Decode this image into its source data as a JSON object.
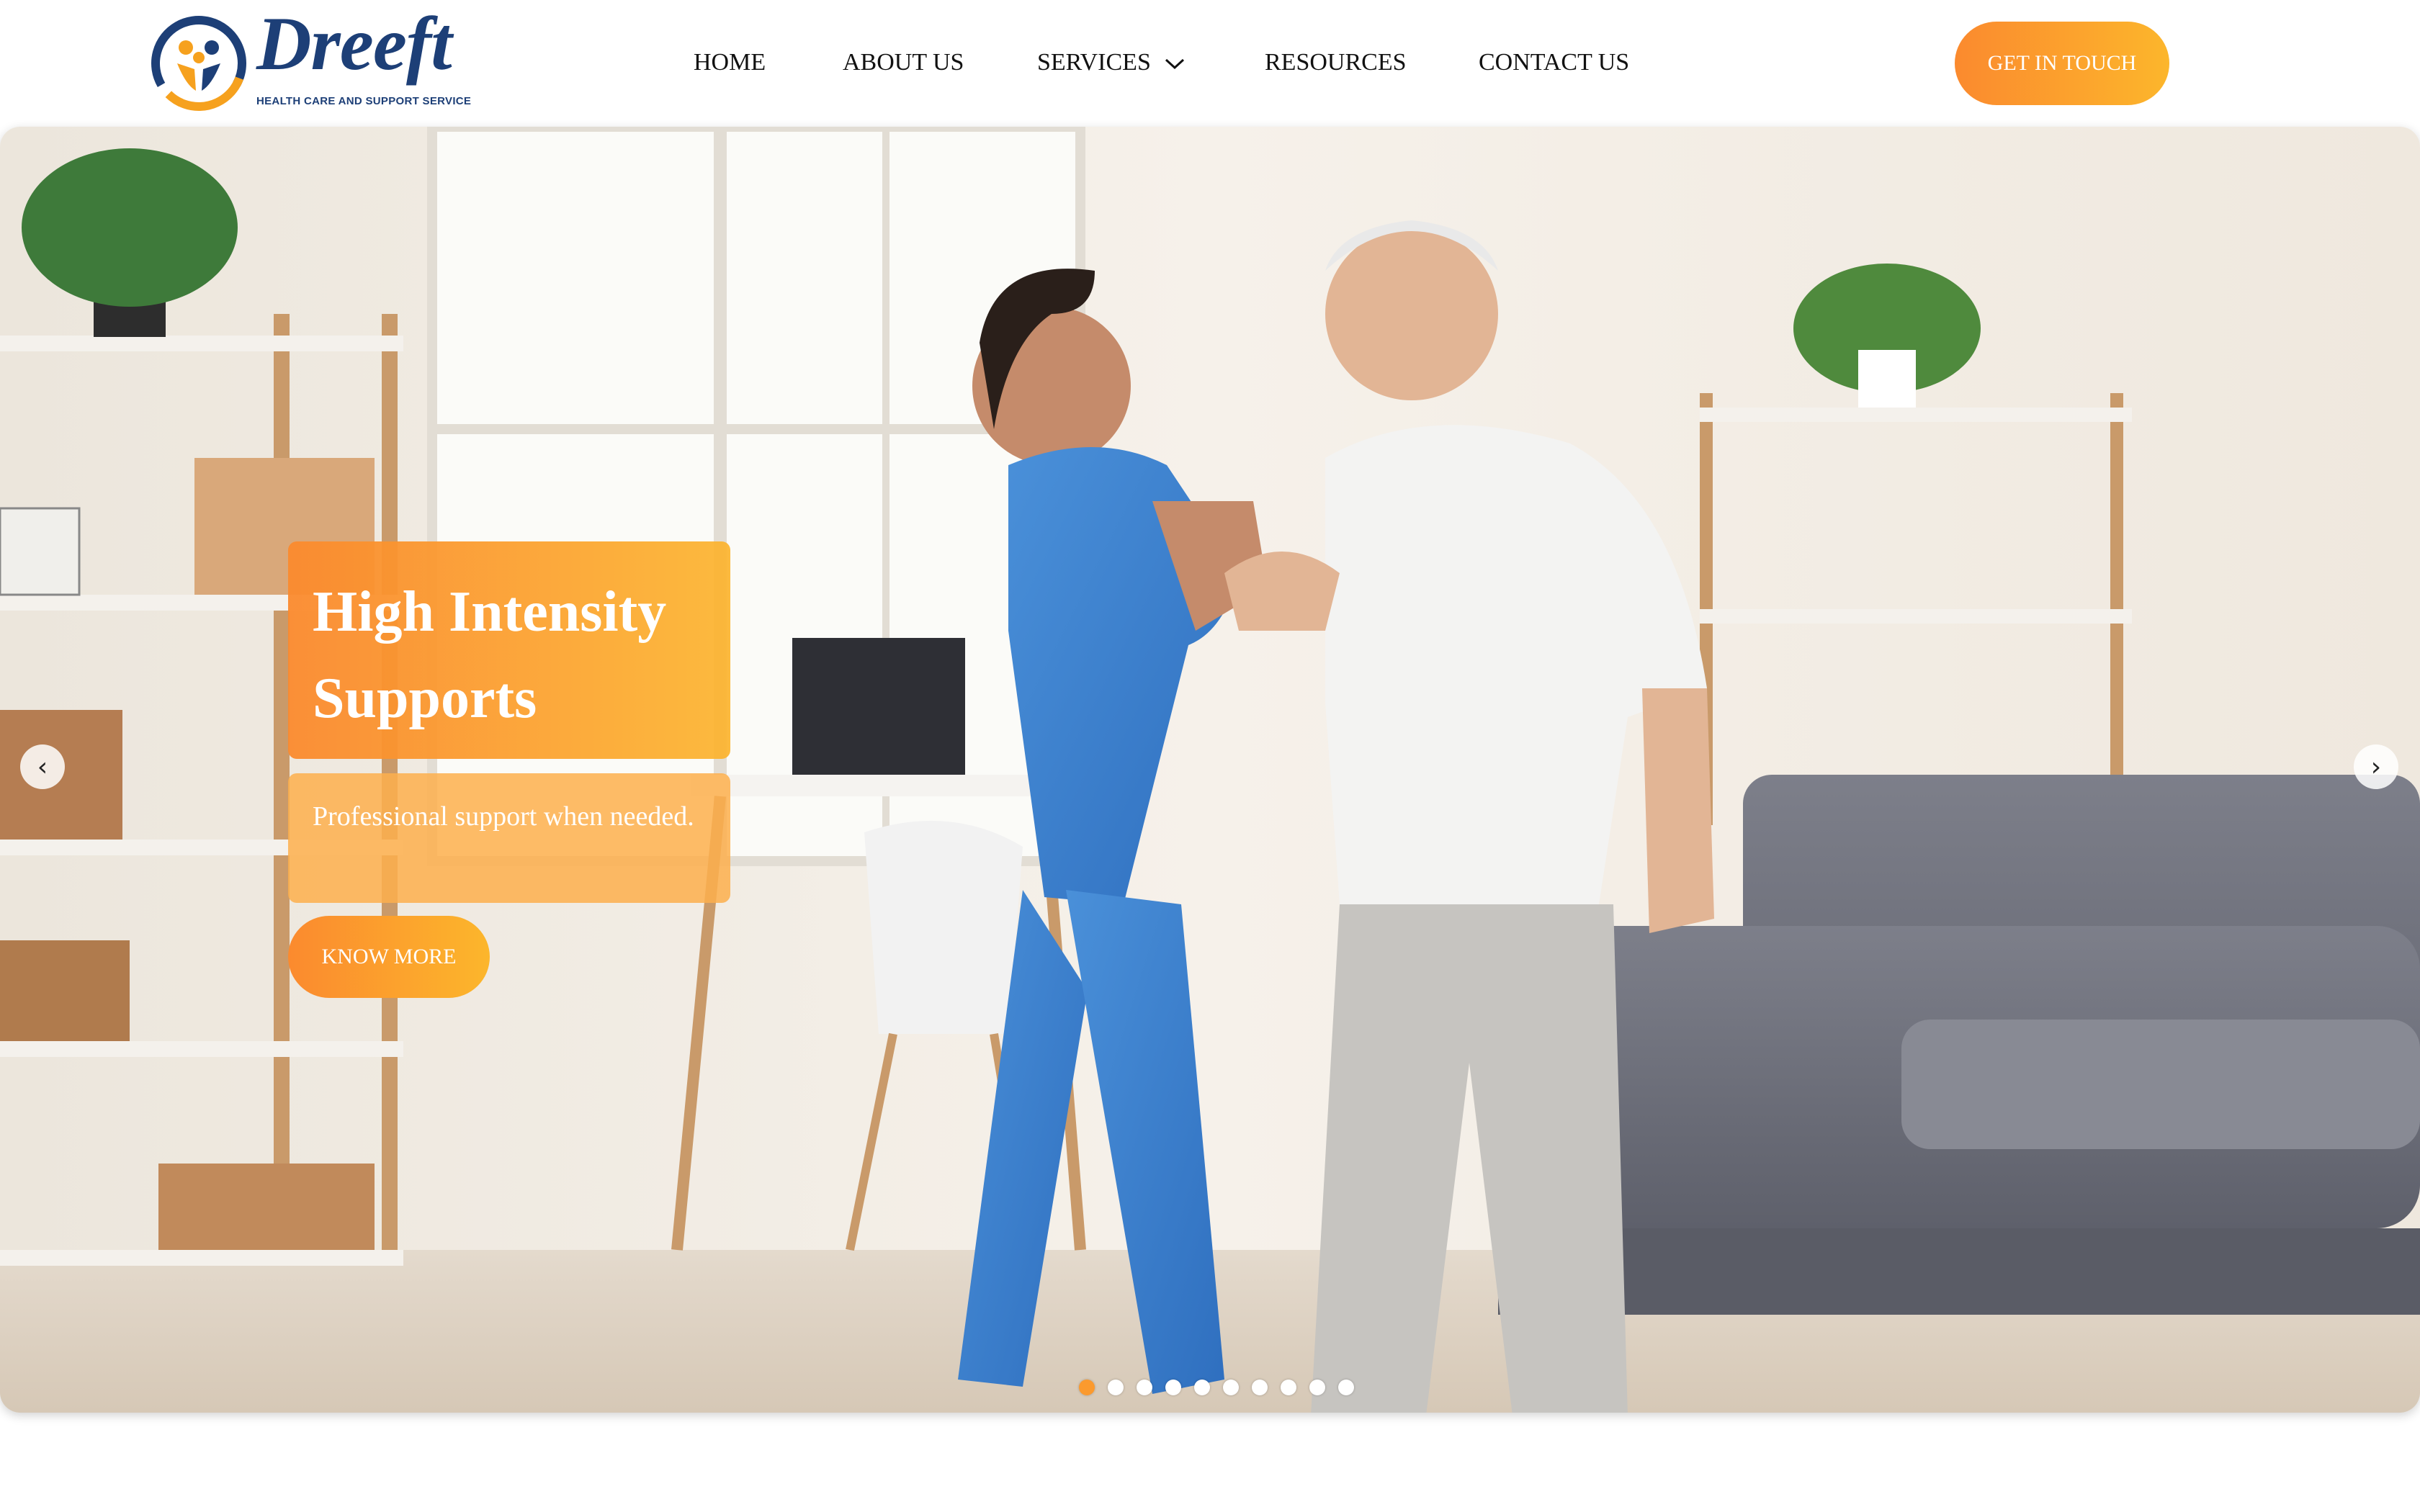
{
  "brand": {
    "name": "Dreeft",
    "tagline": "HEALTH CARE AND SUPPORT SERVICE",
    "colors": {
      "navy": "#1d3f77",
      "orange": "#fb8a2e",
      "amber": "#fcb62c"
    }
  },
  "nav": {
    "items": [
      {
        "label": "HOME"
      },
      {
        "label": "ABOUT US"
      },
      {
        "label": "SERVICES",
        "icon": "chevron-down-icon"
      },
      {
        "label": "RESOURCES"
      },
      {
        "label": "CONTACT US"
      }
    ],
    "cta_label": "GET IN TOUCH"
  },
  "hero": {
    "title": "High Intensity Supports",
    "subtitle": "Professional support when needed.",
    "button_label": "KNOW MORE",
    "prev_icon": "chevron-left-icon",
    "next_icon": "chevron-right-icon",
    "prev_glyph": "‹",
    "next_glyph": "›",
    "slide_count": 10,
    "active_slide": 1
  }
}
